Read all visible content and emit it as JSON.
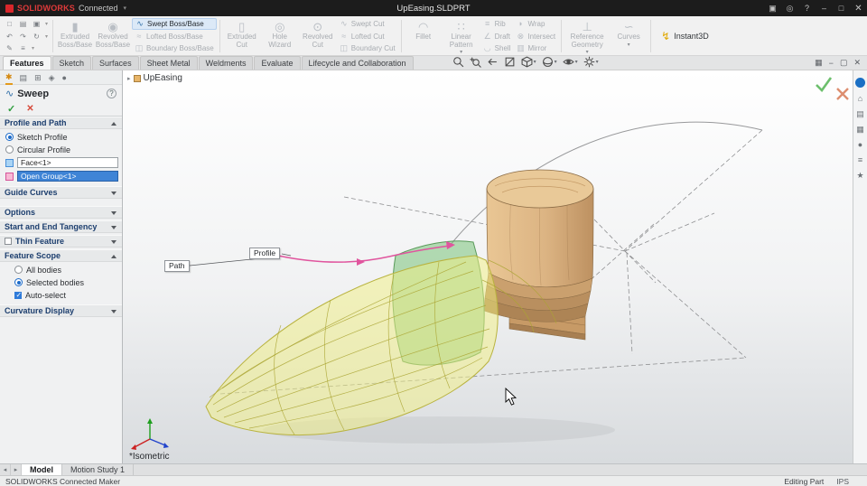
{
  "titlebar": {
    "logo_text": "SOLIDWORKS",
    "logo_suffix": "Connected",
    "document_title": "UpEasing.SLDPRT"
  },
  "ribbon": {
    "buttons": [
      {
        "label": "Extruded Boss/Base",
        "enabled": false
      },
      {
        "label": "Revolved Boss/Base",
        "enabled": false
      },
      {
        "label": "Swept Boss/Base",
        "enabled": true
      },
      {
        "label": "Lofted Boss/Base",
        "enabled": false
      },
      {
        "label": "Boundary Boss/Base",
        "enabled": false
      },
      {
        "label": "Extruded Cut",
        "enabled": false
      },
      {
        "label": "Hole Wizard",
        "enabled": false
      },
      {
        "label": "Revolved Cut",
        "enabled": false
      },
      {
        "label": "Swept Cut",
        "enabled": false
      },
      {
        "label": "Lofted Cut",
        "enabled": false
      },
      {
        "label": "Boundary Cut",
        "enabled": false
      },
      {
        "label": "Fillet",
        "enabled": false
      },
      {
        "label": "Linear Pattern",
        "enabled": false
      },
      {
        "label": "Rib",
        "enabled": false
      },
      {
        "label": "Draft",
        "enabled": false
      },
      {
        "label": "Shell",
        "enabled": false
      },
      {
        "label": "Wrap",
        "enabled": false
      },
      {
        "label": "Intersect",
        "enabled": false
      },
      {
        "label": "Mirror",
        "enabled": false
      },
      {
        "label": "Reference Geometry",
        "enabled": false
      },
      {
        "label": "Curves",
        "enabled": false
      },
      {
        "label": "Instant3D",
        "enabled": true
      }
    ]
  },
  "command_tabs": [
    {
      "label": "Features",
      "active": true
    },
    {
      "label": "Sketch",
      "active": false
    },
    {
      "label": "Surfaces",
      "active": false
    },
    {
      "label": "Sheet Metal",
      "active": false
    },
    {
      "label": "Weldments",
      "active": false
    },
    {
      "label": "Evaluate",
      "active": false
    },
    {
      "label": "Lifecycle and Collaboration",
      "active": false
    }
  ],
  "headsup_icons": [
    "zoom-to-fit",
    "zoom-to-area",
    "previous-view",
    "section-view",
    "view-orientation",
    "display-style",
    "hide-show-items",
    "view-settings"
  ],
  "property_manager": {
    "title": "Sweep",
    "help": "?",
    "accept": "✓",
    "cancel": "✕",
    "profile_and_path": {
      "label": "Profile and Path",
      "radio_sketch": "Sketch Profile",
      "radio_circular": "Circular Profile",
      "profile_value": "Face<1>",
      "path_value": "Open Group<1>"
    },
    "guide_curves_label": "Guide Curves",
    "options_label": "Options",
    "start_end_label": "Start and End Tangency",
    "thin_feature_label": "Thin Feature",
    "feature_scope": {
      "label": "Feature Scope",
      "radio_all": "All bodies",
      "radio_selected": "Selected bodies",
      "check_auto": "Auto-select"
    },
    "curvature_label": "Curvature Display"
  },
  "viewport": {
    "breadcrumb": "UpEasing",
    "profile_callout": "Profile",
    "path_callout": "Path",
    "view_label": "*Isometric"
  },
  "bottom_tabs": [
    {
      "label": "Model",
      "active": true
    },
    {
      "label": "Motion Study 1",
      "active": false
    }
  ],
  "statusbar": {
    "left": "SOLIDWORKS Connected Maker",
    "mode": "Editing Part",
    "units": "IPS"
  },
  "colors": {
    "selection_blue": "#3f84d6",
    "preview_yellow": "#f0ee7c",
    "profile_green": "#7dc87d",
    "path_pink": "#e0559e",
    "wood": "#d9b183",
    "accept_green": "#4caf50",
    "cancel_red": "#d9825f"
  }
}
